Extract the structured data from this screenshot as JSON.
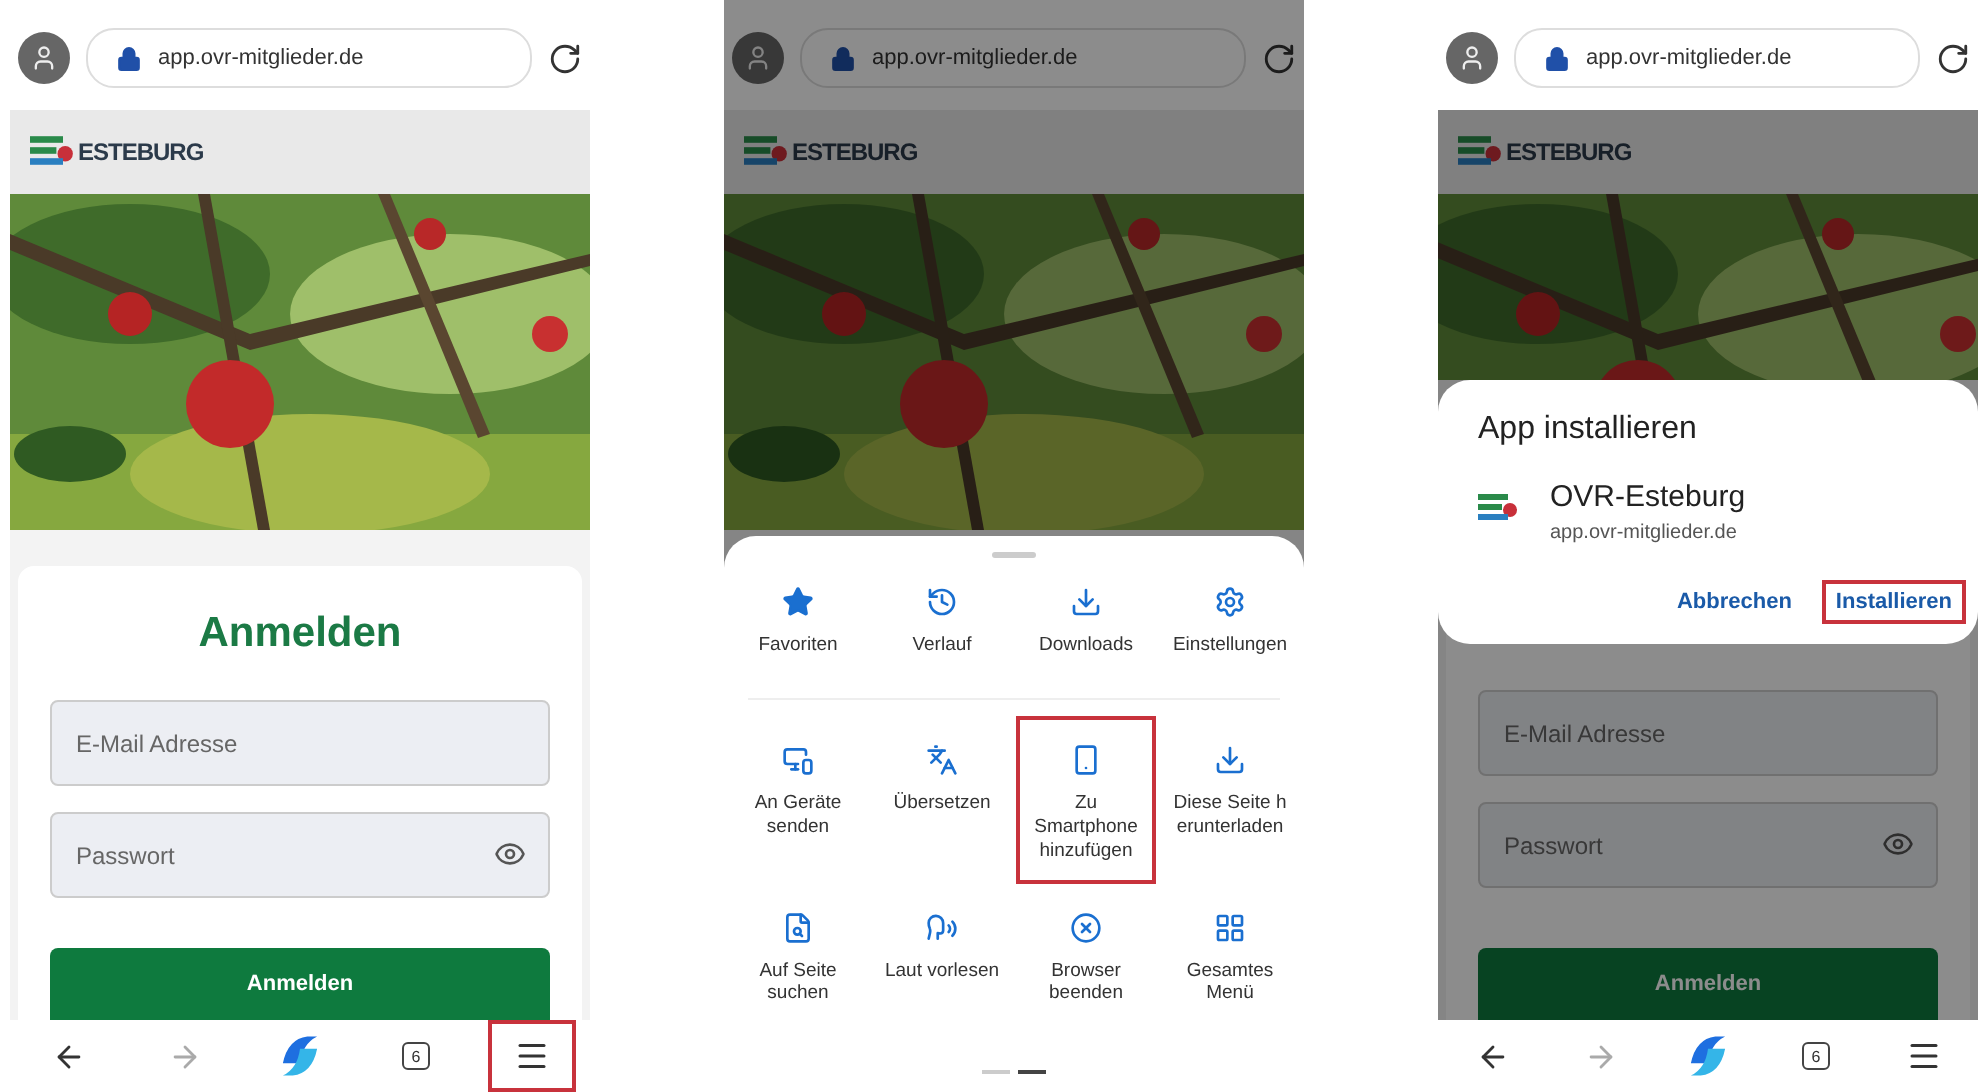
{
  "screens": [
    {
      "kind": "login",
      "url": "app.ovr-mitglieder.de",
      "brand": "ESTEBURG",
      "title": "Anmelden",
      "fields": [
        {
          "kind": "email",
          "placeholder": "E-Mail Adresse"
        },
        {
          "kind": "password",
          "placeholder": "Passwort"
        }
      ],
      "submit": "Anmelden",
      "nav": [
        {
          "kind": "back",
          "highlighted": false
        },
        {
          "kind": "forward",
          "highlighted": false
        },
        {
          "kind": "copilot",
          "highlighted": false
        },
        {
          "kind": "tabs",
          "label": "6",
          "highlighted": false
        },
        {
          "kind": "menu",
          "highlighted": true
        }
      ]
    },
    {
      "kind": "menu",
      "url": "app.ovr-mitglieder.de",
      "brand": "ESTEBURG",
      "favorites": [
        {
          "label": "Favoriten"
        },
        {
          "label": "Verlauf"
        },
        {
          "label": "Downloads"
        },
        {
          "label": "Einstellungen"
        }
      ],
      "actions": [
        {
          "label": "An Geräte\nsenden",
          "highlighted": false
        },
        {
          "label": "Übersetzen",
          "highlighted": false
        },
        {
          "label": "Zu\nSmartphone\nhinzufügen",
          "highlighted": true
        },
        {
          "label": "Diese Seite h\nerunterladen",
          "highlighted": false
        },
        {
          "label": "Auf Seite\nsuchen",
          "highlighted": false
        },
        {
          "label": "Laut vorlesen",
          "highlighted": false
        },
        {
          "label": "Browser\nbeenden",
          "highlighted": false
        },
        {
          "label": "Gesamtes\nMenü",
          "highlighted": false
        }
      ]
    },
    {
      "kind": "install",
      "url": "app.ovr-mitglieder.de",
      "brand": "ESTEBURG",
      "fields": [
        {
          "kind": "email",
          "placeholder": "E-Mail Adresse"
        },
        {
          "kind": "password",
          "placeholder": "Passwort"
        }
      ],
      "submit": "Anmelden",
      "dialog": {
        "title": "App installieren",
        "app_name": "OVR-Esteburg",
        "app_url": "app.ovr-mitglieder.de",
        "buttons": [
          {
            "label": "Abbrechen",
            "highlighted": false
          },
          {
            "label": "Installieren",
            "highlighted": true
          }
        ]
      },
      "nav": [
        {
          "kind": "back",
          "highlighted": false
        },
        {
          "kind": "forward",
          "highlighted": false
        },
        {
          "kind": "copilot",
          "highlighted": false
        },
        {
          "kind": "tabs",
          "label": "6",
          "highlighted": false
        },
        {
          "kind": "menu",
          "highlighted": false
        }
      ]
    }
  ]
}
